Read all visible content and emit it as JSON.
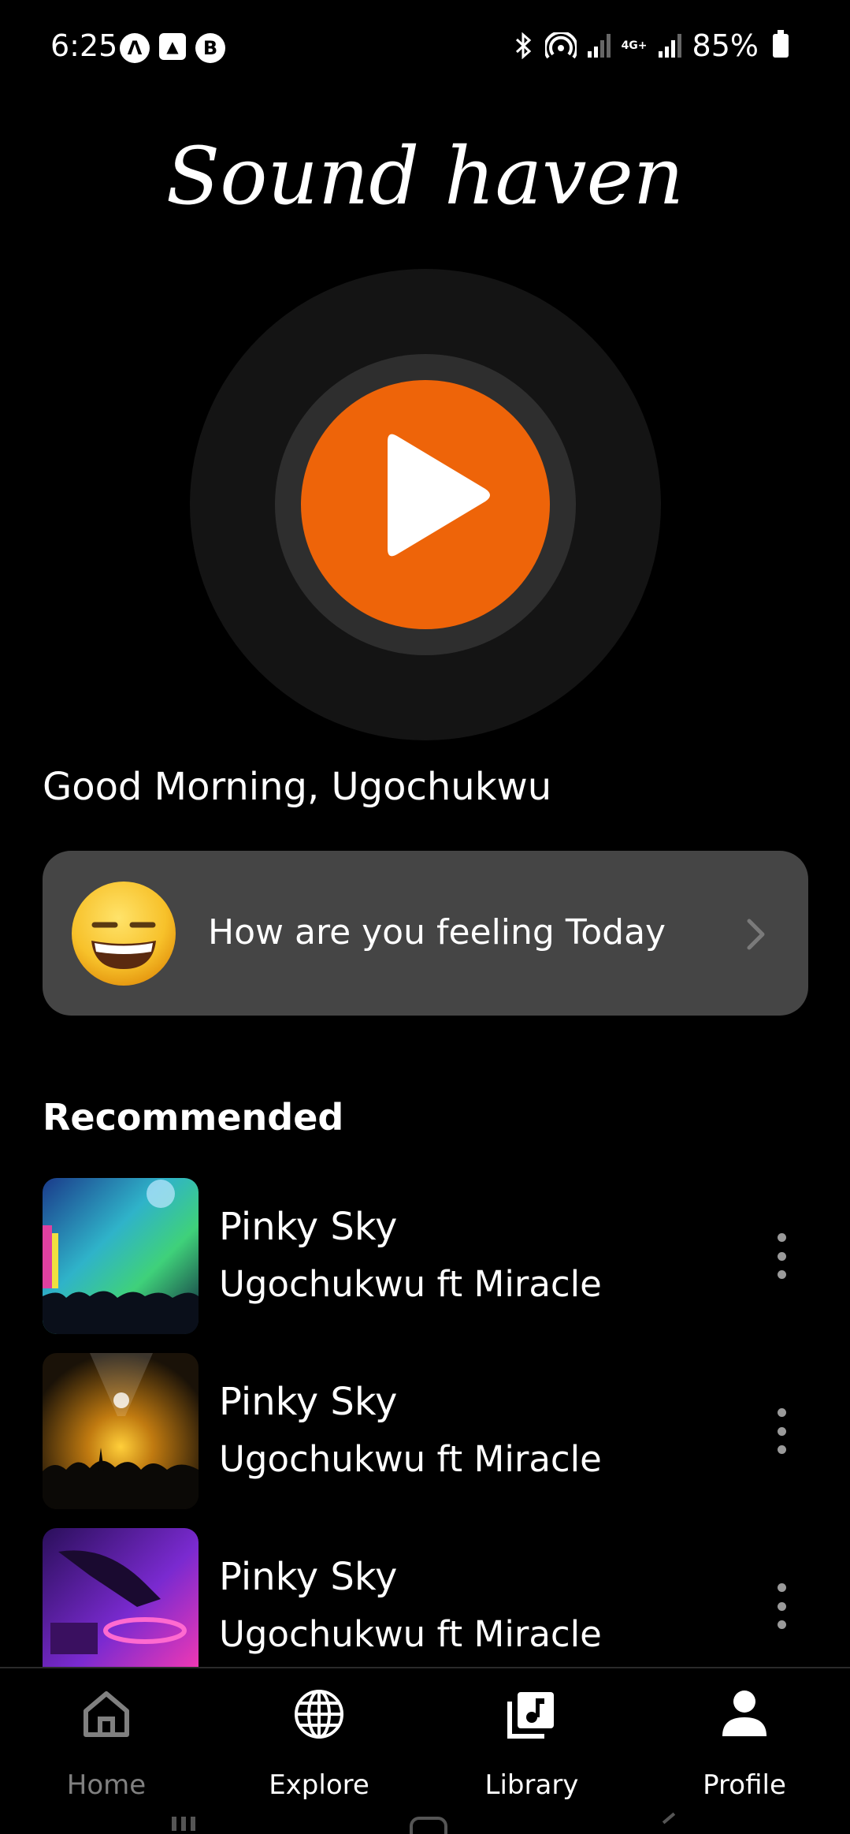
{
  "status_bar": {
    "time": "6:25",
    "left_icons": [
      "nav-app-icon",
      "gallery-icon",
      "b-app-icon"
    ],
    "network_label": "4G+",
    "battery": "85%"
  },
  "app": {
    "title": "Sound haven",
    "accent_color": "#ee6409"
  },
  "greeting": "Good Morning, Ugochukwu",
  "mood_card": {
    "emoji": "grinning-face-icon",
    "prompt": "How are you feeling Today"
  },
  "recommended": {
    "title": "Recommended",
    "items": [
      {
        "title": "Pinky Sky",
        "artist": "Ugochukwu ft Miracle",
        "thumb": "concert-crowd-lights"
      },
      {
        "title": "Pinky Sky",
        "artist": "Ugochukwu ft Miracle",
        "thumb": "stage-yellow-lights"
      },
      {
        "title": "Pinky Sky",
        "artist": "Ugochukwu ft Miracle",
        "thumb": "dj-purple-lights"
      }
    ]
  },
  "bottom_nav": {
    "items": [
      {
        "label": "Home",
        "icon": "home-icon",
        "active": false
      },
      {
        "label": "Explore",
        "icon": "globe-icon",
        "active": true
      },
      {
        "label": "Library",
        "icon": "library-music-icon",
        "active": true
      },
      {
        "label": "Profile",
        "icon": "person-icon",
        "active": true
      }
    ]
  }
}
